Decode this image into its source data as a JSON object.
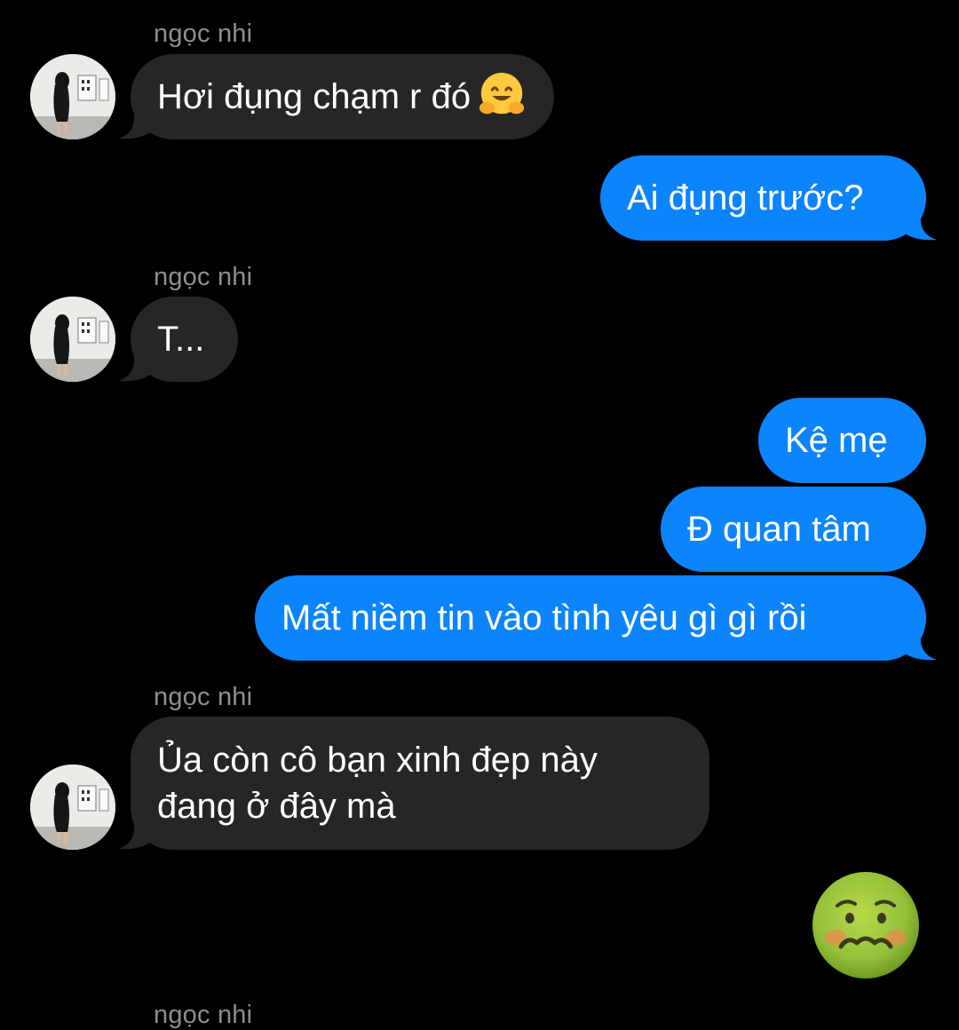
{
  "thread": {
    "contact_name": "ngọc nhi",
    "messages": [
      {
        "from": "them",
        "text": "Hơi đụng chạm r đó",
        "emoji": "hugging-face-emoji"
      },
      {
        "from": "me",
        "text": "Ai đụng trước?"
      },
      {
        "from": "them",
        "text": "T..."
      },
      {
        "from": "me",
        "text": "Kệ mẹ"
      },
      {
        "from": "me",
        "text": "Đ quan tâm"
      },
      {
        "from": "me",
        "text": "Mất niềm tin vào tình yêu gì gì rồi"
      },
      {
        "from": "them",
        "line1": "Ủa còn cô bạn xinh đẹp này",
        "line2": "đang ở đây mà"
      },
      {
        "from": "me",
        "emoji": "nauseated-face-emoji"
      }
    ]
  },
  "colors": {
    "background": "#000000",
    "incoming_bubble": "#262628",
    "outgoing_bubble": "#0b84fe",
    "sender_label": "#8e8e93"
  }
}
